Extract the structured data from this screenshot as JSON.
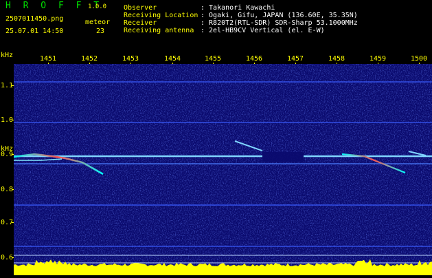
{
  "app": {
    "logo": "H R O F F T",
    "version": "1.0.0"
  },
  "file": {
    "name": "2507011450.png",
    "datetime": "25.07.01 14:50"
  },
  "meteor": {
    "label": "meteor",
    "count": "23"
  },
  "info": {
    "observer_label": "Observer",
    "observer_value": ": Takanori Kawachi",
    "location_label": "Receiving Location",
    "location_value": ": Ogaki, Gifu, JAPAN (136.60E, 35.35N)",
    "receiver_label": "Receiver",
    "receiver_value": ": R820T2(RTL-SDR) SDR-Sharp 53.1000MHz",
    "antenna_label": "Receiving antenna",
    "antenna_value": ": 2el-HB9CV Vertical (el. E-W)"
  },
  "axis": {
    "y_unit_top": "kHz",
    "y_unit_mid": "kHz",
    "x_ticks": [
      "1451",
      "1452",
      "1453",
      "1454",
      "1455",
      "1456",
      "1457",
      "1458",
      "1459",
      "1500"
    ],
    "y_ticks": [
      "1.1",
      "1.0",
      "0.9",
      "0.8",
      "0.7",
      "0.6"
    ]
  },
  "colors": {
    "background": "#0a0a6e",
    "label": "#ffff00",
    "info": "#ffffff",
    "logo": "#00e000",
    "baseline": "#ffff00",
    "noise_floor": "#00c8ff"
  }
}
